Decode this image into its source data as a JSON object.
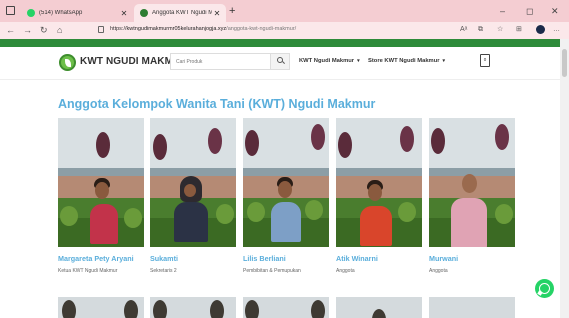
{
  "browser": {
    "tabs": [
      {
        "title": "(514) WhatsApp",
        "active": false
      },
      {
        "title": "Anggota KWT Ngudi Makmur – …",
        "active": true
      }
    ],
    "new_tab": "+",
    "window_controls": {
      "minimize": "–",
      "maximize": "◻",
      "close": "✕"
    },
    "address": {
      "protocol": "https://",
      "host": "kwtngudimakmurmr05kelurahanjogja.xyz",
      "path": "/anggota-kwt-ngudi-makmur/"
    },
    "toolbar_icons": [
      "read-aloud-icon",
      "extensions-icon",
      "favorites-icon",
      "collections-icon",
      "profile-icon",
      "more-icon"
    ]
  },
  "site": {
    "name": "KWT NGUDI MAKMUR",
    "search_placeholder": "Cari Produk",
    "menu": [
      {
        "label": "KWT Ngudi Makmur",
        "has_dropdown": true
      },
      {
        "label": "Store KWT Ngudi Makmur",
        "has_dropdown": true
      }
    ],
    "cart_count": "0"
  },
  "page": {
    "title": "Anggota Kelompok Wanita Tani (KWT) Ngudi Makmur"
  },
  "members": [
    {
      "name": "Margareta Pety Aryani",
      "role": "Ketua KWT Ngudi Makmur"
    },
    {
      "name": "Sukamti",
      "role": "Sekretaris 2"
    },
    {
      "name": "Lilis Berliani",
      "role": "Pembibitan & Pemupukan"
    },
    {
      "name": "Atik Winarni",
      "role": "Anggota"
    },
    {
      "name": "Murwani",
      "role": "Anggota"
    }
  ],
  "colors": {
    "accent": "#5aaedb",
    "brand_green": "#2e8b3a",
    "tab_strip": "#f4cdd2",
    "whatsapp": "#25d366"
  }
}
